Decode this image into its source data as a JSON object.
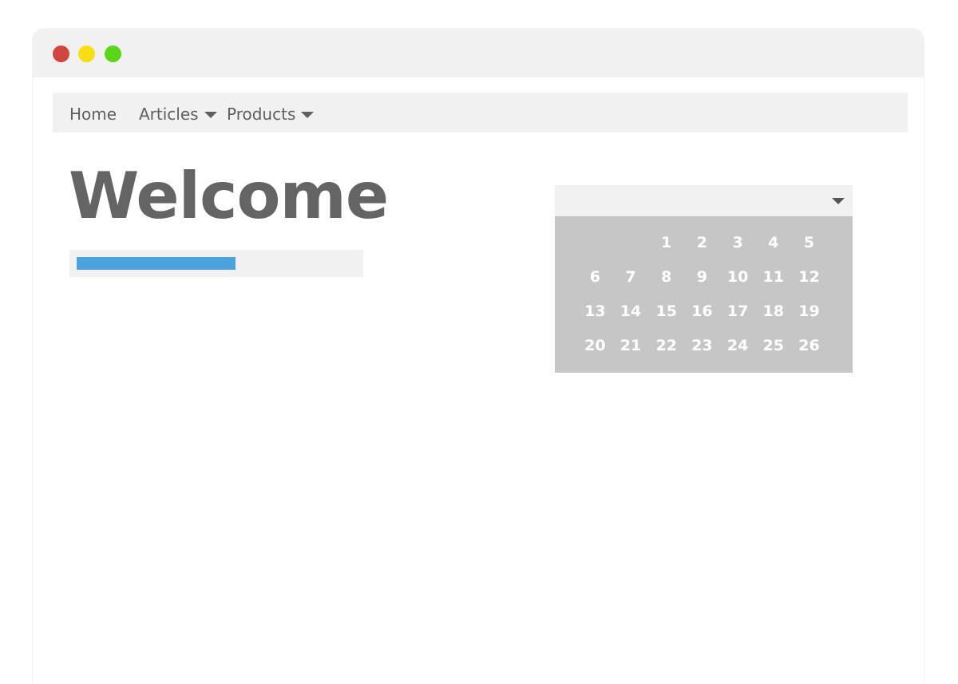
{
  "window": {
    "controls": [
      "close",
      "minimize",
      "maximize"
    ],
    "colors": {
      "close": "#d0453f",
      "minimize": "#f7de10",
      "maximize": "#5ad51a"
    }
  },
  "nav": {
    "home": "Home",
    "articles": "Articles",
    "products": "Products"
  },
  "main": {
    "title": "Welcome",
    "progress": 0.57,
    "progress_color": "#4aa3dd"
  },
  "calendar": {
    "leading_blanks": 2,
    "days": [
      "1",
      "2",
      "3",
      "4",
      "5",
      "6",
      "7",
      "8",
      "9",
      "10",
      "11",
      "12",
      "13",
      "14",
      "15",
      "16",
      "17",
      "18",
      "19",
      "20",
      "21",
      "22",
      "23",
      "24",
      "25",
      "26"
    ]
  }
}
